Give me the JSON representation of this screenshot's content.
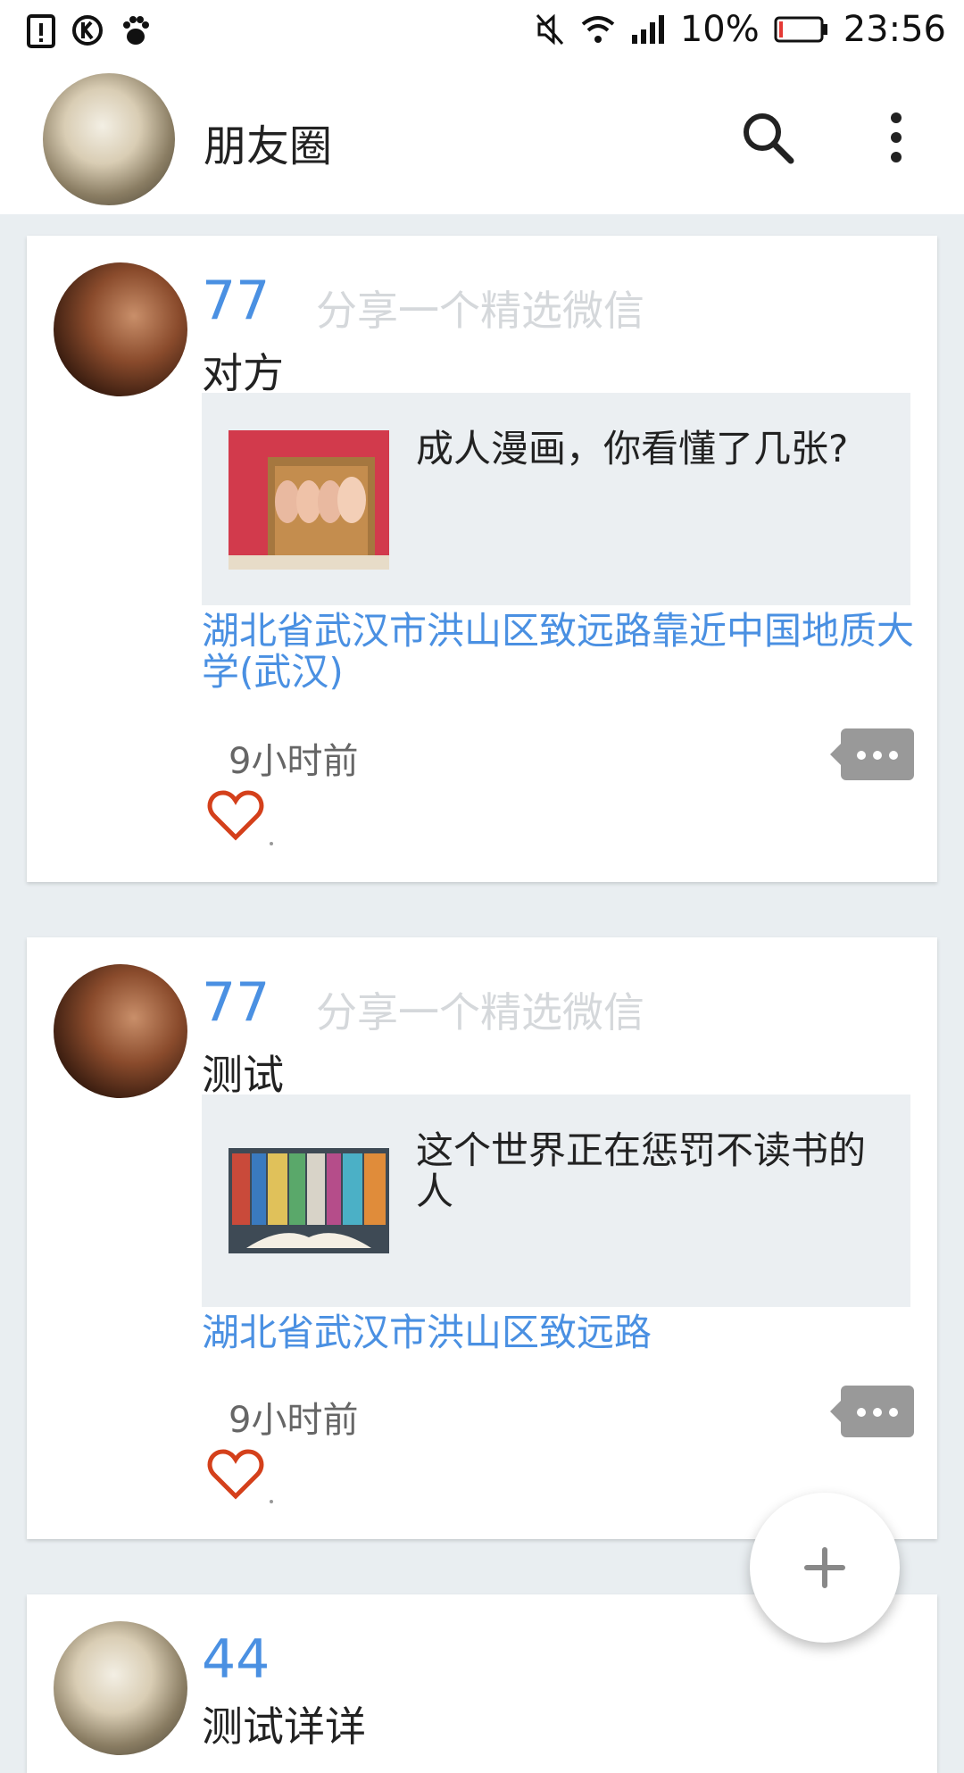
{
  "status_bar": {
    "battery_percent": "10%",
    "time": "23:56",
    "left_icons": [
      "alert-icon",
      "k-icon",
      "baidu-paw-icon"
    ],
    "right_icons": [
      "mute-icon",
      "wifi-icon",
      "signal-icon",
      "battery-icon"
    ]
  },
  "appbar": {
    "title": "朋友圈"
  },
  "posts": [
    {
      "name": "77",
      "tag": "分享一个精选微信",
      "content": "对方",
      "share_text": "成人漫画，你看懂了几张?",
      "location": "湖北省武汉市洪山区致远路靠近中国地质大学(武汉)",
      "time": "9小时前"
    },
    {
      "name": "77",
      "tag": "分享一个精选微信",
      "content": "测试",
      "share_text": "这个世界正在惩罚不读书的人",
      "location": "湖北省武汉市洪山区致远路",
      "time": "9小时前"
    },
    {
      "name": "44",
      "content": "测试详详"
    }
  ],
  "colors": {
    "accent_blue": "#4a90e2",
    "heart_red": "#d4401b",
    "background": "#e9eef1"
  }
}
